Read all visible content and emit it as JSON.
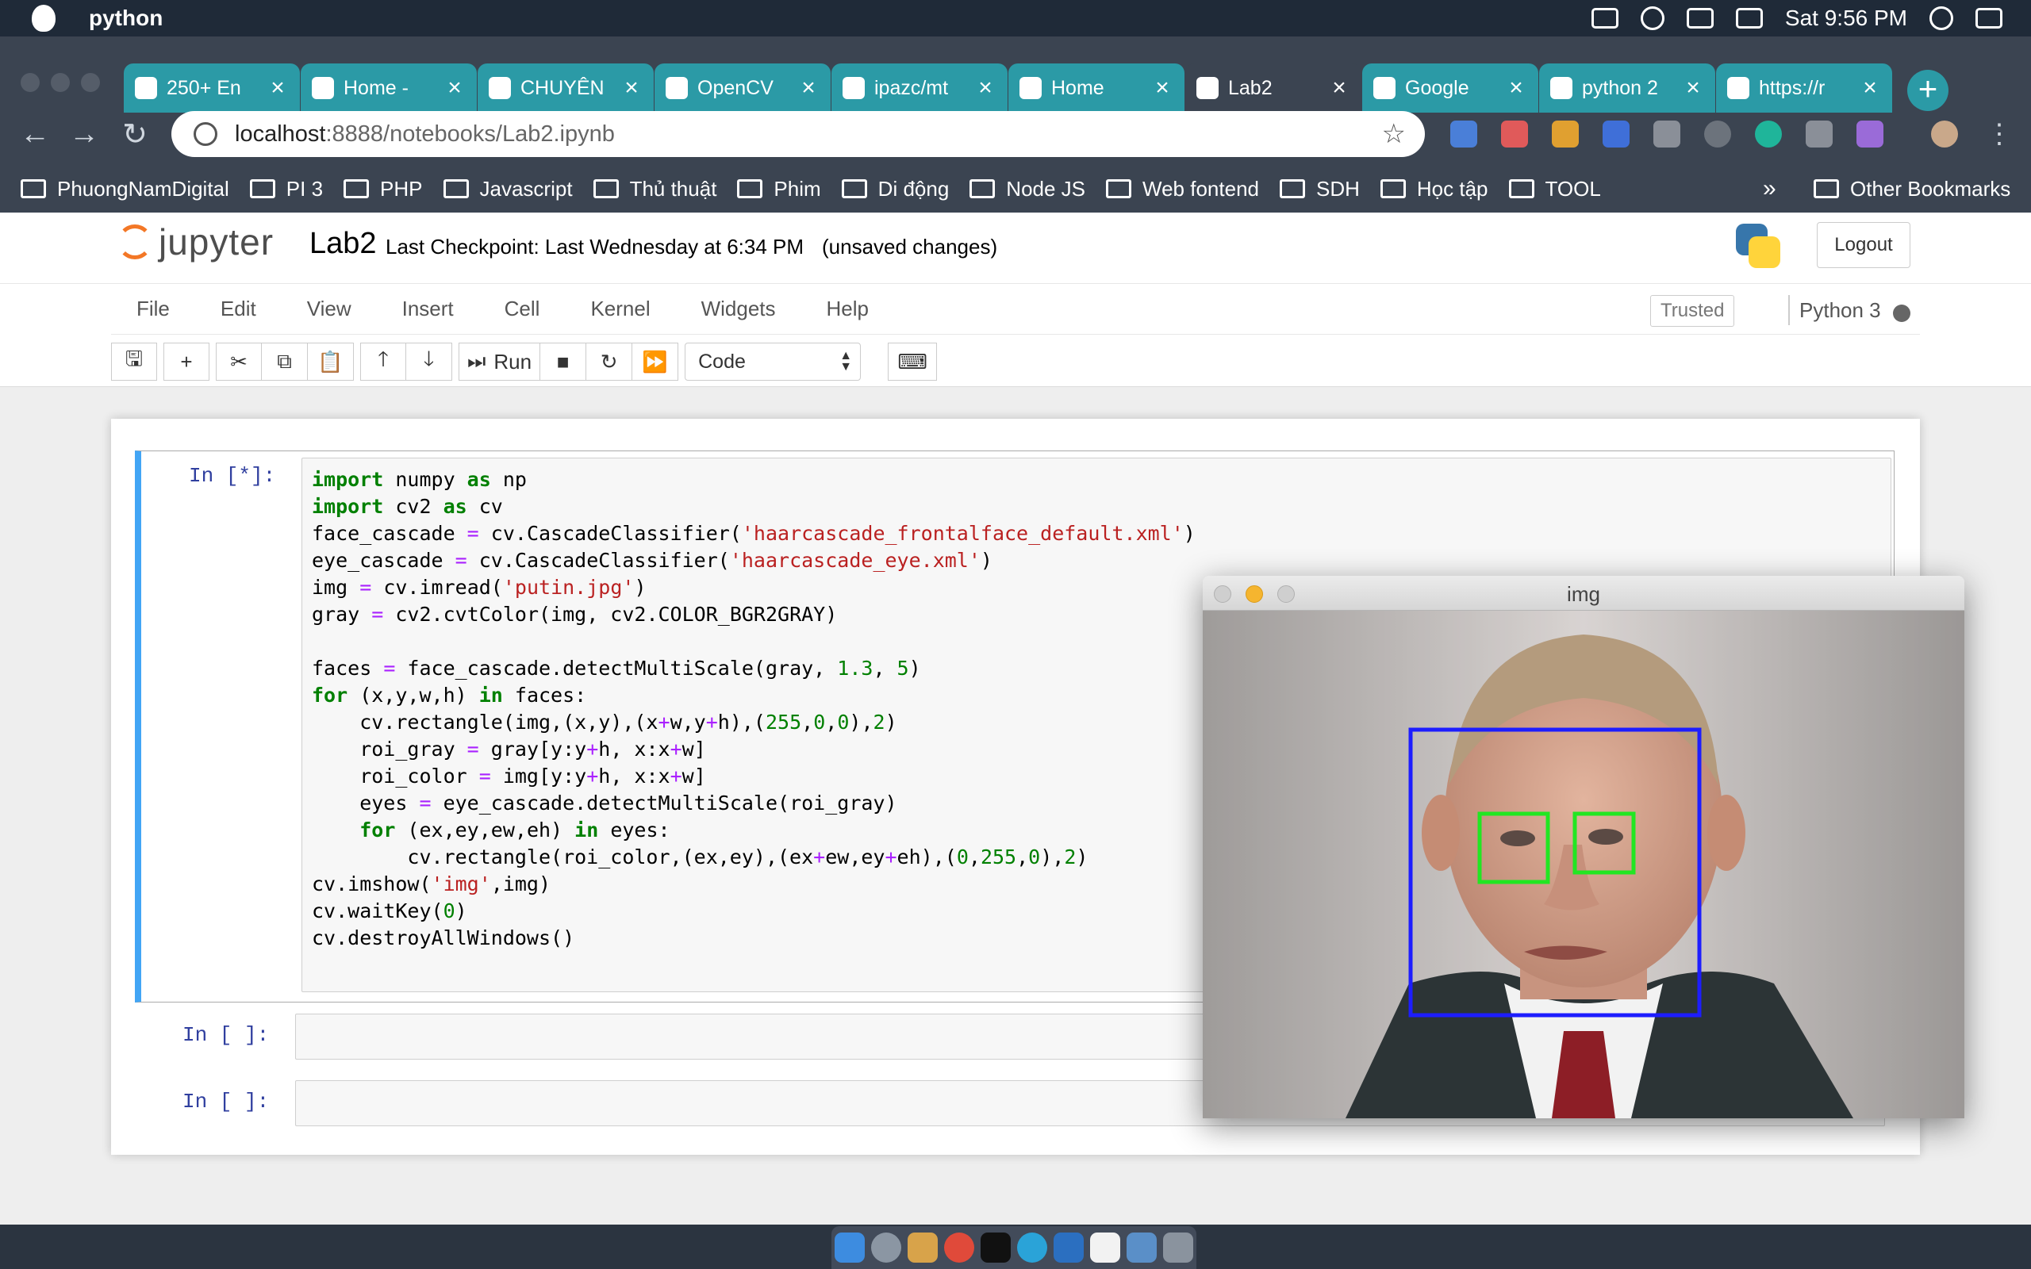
{
  "os": {
    "app_name": "python",
    "clock": "Sat 9:56 PM"
  },
  "browser": {
    "tabs": [
      {
        "title": "250+ En",
        "icon": "tab-favicon",
        "color": "#2b9aa6"
      },
      {
        "title": "Home - ",
        "icon": "tab-favicon",
        "color": "#2b9aa6"
      },
      {
        "title": "CHUYÊN",
        "icon": "tab-favicon",
        "color": "#2b9aa6"
      },
      {
        "title": "OpenCV",
        "icon": "opencv-icon",
        "color": "#2b9aa6"
      },
      {
        "title": "ipazc/mt",
        "icon": "github-icon",
        "color": "#2b9aa6"
      },
      {
        "title": "Home",
        "icon": "jupyter-icon",
        "color": "#2b9aa6"
      },
      {
        "title": "Lab2",
        "icon": "hourglass-icon",
        "color": "#3b4451"
      },
      {
        "title": "Google ",
        "icon": "calendar-icon",
        "color": "#2b9aa6"
      },
      {
        "title": "python 2",
        "icon": "tab-favicon",
        "color": "#2b9aa6"
      },
      {
        "title": "https://r",
        "icon": "page-icon",
        "color": "#2b9aa6"
      }
    ],
    "url_host": "localhost",
    "url_path": ":8888/notebooks/Lab2.ipynb",
    "bookmarks": [
      "PhuongNamDigital",
      "PI 3",
      "PHP",
      "Javascript",
      "Thủ thuật",
      "Phim",
      "Di động",
      "Node JS",
      "Web fontend",
      "SDH",
      "Học tập",
      "TOOL"
    ],
    "bookmarks_more": "»",
    "other_bookmarks": "Other Bookmarks"
  },
  "jupyter": {
    "logo_text": "jupyter",
    "notebook_name": "Lab2",
    "checkpoint": "Last Checkpoint: Last Wednesday at 6:34 PM",
    "unsaved": "(unsaved changes)",
    "logout": "Logout",
    "menus": [
      "File",
      "Edit",
      "View",
      "Insert",
      "Cell",
      "Kernel",
      "Widgets",
      "Help"
    ],
    "trusted": "Trusted",
    "kernel": "Python 3",
    "run_label": "Run",
    "cell_type": "Code",
    "cells": [
      {
        "prompt": "In [*]:"
      },
      {
        "prompt": "In [ ]:"
      },
      {
        "prompt": "In [ ]:"
      }
    ]
  },
  "image_window": {
    "title": "img"
  }
}
